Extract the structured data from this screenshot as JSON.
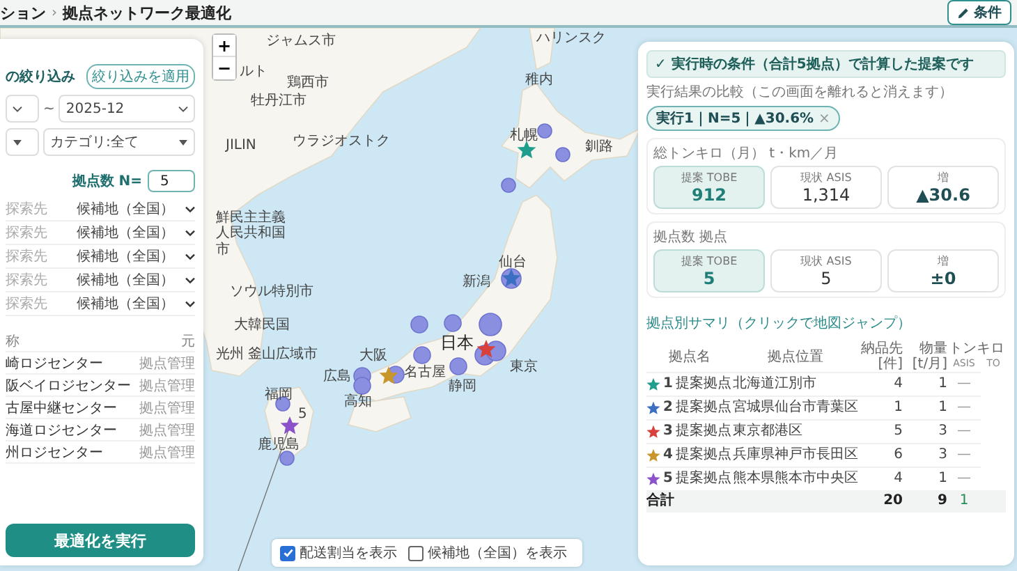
{
  "header": {
    "breadcrumb": "ション",
    "separator": "›",
    "title": "拠点ネットワーク最適化",
    "edit_button": "条件"
  },
  "map": {
    "labels": [
      "ルト",
      "ジャムス市",
      "鶏西市",
      "牡丹江市",
      "JILIN",
      "ウラジオストク",
      "鮮民主主義",
      "人民共和国",
      "市",
      "ソウル特別市",
      "大韓民国",
      "光州",
      "釜山広域市",
      "広島",
      "福岡",
      "高知",
      "5",
      "鹿児島",
      "ハリンスク",
      "稚内",
      "札幌",
      "釧路",
      "新潟",
      "仙台",
      "日本",
      "東京",
      "名古屋",
      "大阪",
      "静岡"
    ],
    "zoom_in": "+",
    "zoom_out": "−",
    "layers": [
      {
        "label": "配送割当を表示",
        "checked": true
      },
      {
        "label": "候補地（全国）を表示",
        "checked": false
      }
    ]
  },
  "filter_panel": {
    "section_title": "の絞り込み",
    "apply_button": "絞り込みを適用",
    "range_separator": "~",
    "period_to": "2025-12",
    "category": "カテゴリ:全て",
    "n_label": "拠点数 N=",
    "n_value": "5",
    "slots": [
      {
        "label": "探索先",
        "value": "候補地（全国）"
      },
      {
        "label": "探索先",
        "value": "候補地（全国）"
      },
      {
        "label": "探索先",
        "value": "候補地（全国）"
      },
      {
        "label": "探索先",
        "value": "候補地（全国）"
      },
      {
        "label": "探索先",
        "value": "候補地（全国）"
      }
    ],
    "table": {
      "columns": [
        "称",
        "元"
      ],
      "rows": [
        [
          "崎ロジセンター",
          "拠点管理"
        ],
        [
          "阪ベイロジセンター",
          "拠点管理"
        ],
        [
          "古屋中継センター",
          "拠点管理"
        ],
        [
          "海道ロジセンター",
          "拠点管理"
        ],
        [
          "州ロジセンター",
          "拠点管理"
        ]
      ]
    },
    "run_button": "最適化を実行"
  },
  "result_panel": {
    "banner": "✓ 実行時の条件（合計5拠点）で計算した提案です",
    "compare_label": "実行結果の比較（この画面を離れると消えます）",
    "chips": [
      {
        "label": "実行1｜N=5｜▲30.6%",
        "close": "×"
      }
    ],
    "metrics": [
      {
        "title": "総トンキロ（月） t・km／月",
        "cards": [
          {
            "kind": "tobe",
            "label": "提案 TOBE",
            "value": "912"
          },
          {
            "kind": "asis",
            "label": "現状 ASIS",
            "value": "1,314"
          },
          {
            "kind": "delta",
            "label": "増",
            "value": "▲30.6"
          }
        ]
      },
      {
        "title": "拠点数 拠点",
        "cards": [
          {
            "kind": "tobe",
            "label": "提案 TOBE",
            "value": "5"
          },
          {
            "kind": "asis",
            "label": "現状 ASIS",
            "value": "5"
          },
          {
            "kind": "delta",
            "label": "増",
            "value": "±0"
          }
        ]
      }
    ],
    "summary": {
      "title": "拠点別サマリ（クリックで地図ジャンプ）",
      "columns": [
        "拠点名",
        "拠点位置",
        "納品先 [件]",
        "物量 [t/月]"
      ],
      "group_column": "トンキロ",
      "sub_columns": [
        "ASIS",
        "TO"
      ],
      "rows": [
        {
          "color": "#1f9e8e",
          "no": "1",
          "name": "提案拠点",
          "location": "北海道江別市",
          "deliveries": "4",
          "volume": "1",
          "asis": "—"
        },
        {
          "color": "#3a6fc1",
          "no": "2",
          "name": "提案拠点",
          "location": "宮城県仙台市青葉区",
          "deliveries": "1",
          "volume": "1",
          "asis": "—"
        },
        {
          "color": "#d8403b",
          "no": "3",
          "name": "提案拠点",
          "location": "東京都港区",
          "deliveries": "5",
          "volume": "3",
          "asis": "—"
        },
        {
          "color": "#c9962b",
          "no": "4",
          "name": "提案拠点",
          "location": "兵庫県神戸市長田区",
          "deliveries": "6",
          "volume": "3",
          "asis": "—"
        },
        {
          "color": "#8c52c9",
          "no": "5",
          "name": "提案拠点",
          "location": "熊本県熊本市中央区",
          "deliveries": "4",
          "volume": "1",
          "asis": "—"
        }
      ],
      "total": {
        "label": "合計",
        "deliveries": "20",
        "volume": "9",
        "asis": "1"
      }
    }
  }
}
